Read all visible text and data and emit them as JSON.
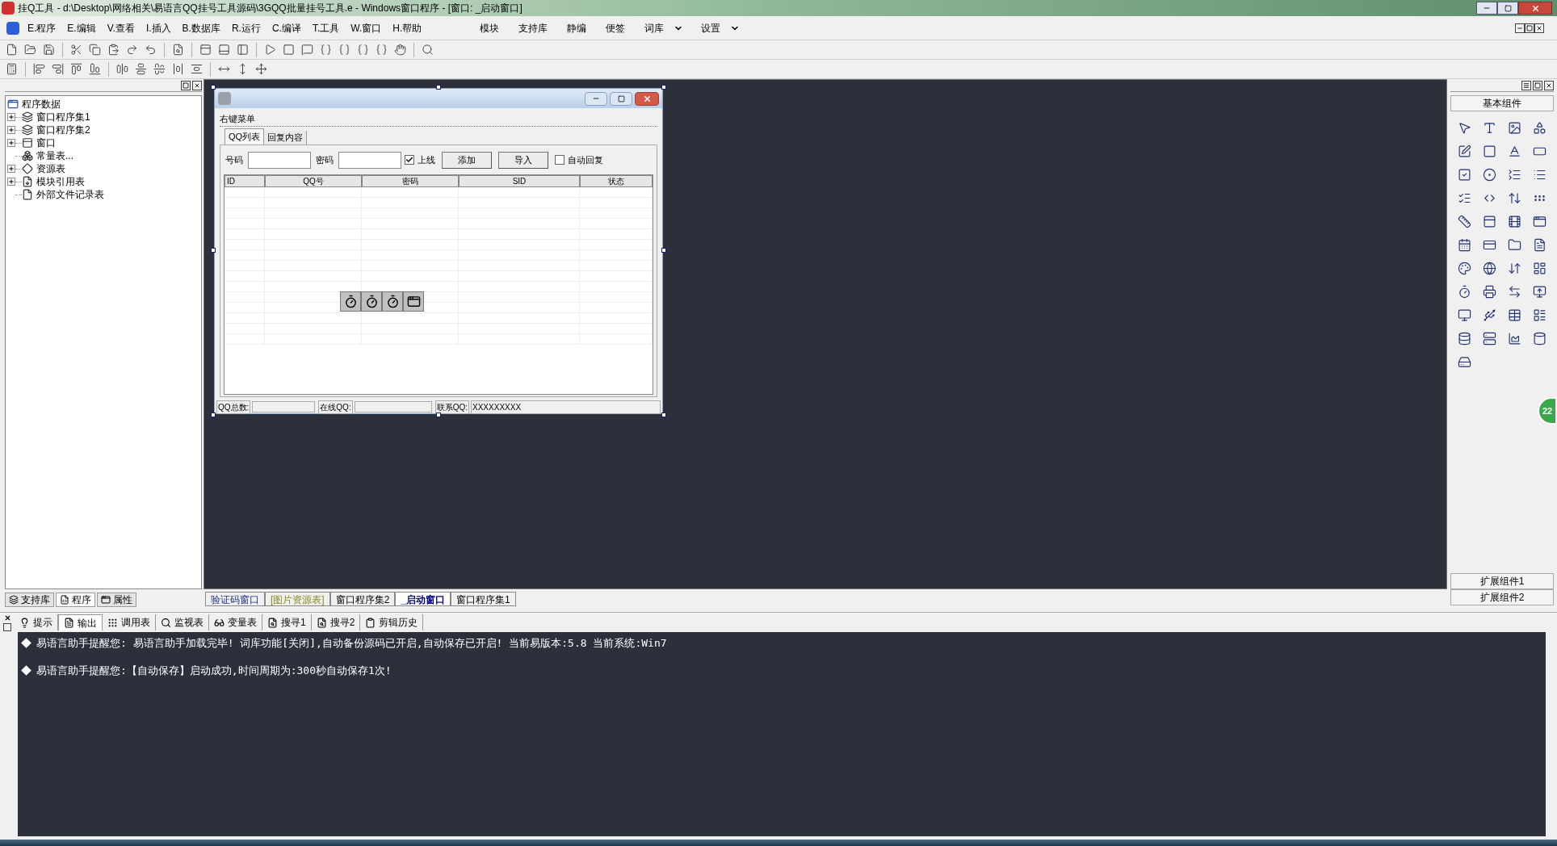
{
  "window": {
    "title": "挂Q工具 - d:\\Desktop\\网络相关\\易语言QQ挂号工具源码\\3GQQ批量挂号工具.e - Windows窗口程序 - [窗口: _启动窗口]"
  },
  "menu": [
    "E.程序",
    "E.编辑",
    "V.查看",
    "I.插入",
    "B.数据库",
    "R.运行",
    "C.编译",
    "T.工具",
    "W.窗口",
    "H.帮助"
  ],
  "menu_right": [
    {
      "label": "模块",
      "dropdown": false
    },
    {
      "label": "支持库",
      "dropdown": false
    },
    {
      "label": "静编",
      "dropdown": false
    },
    {
      "label": "便签",
      "dropdown": false
    },
    {
      "label": "词库",
      "dropdown": true
    },
    {
      "label": "设置",
      "dropdown": true
    }
  ],
  "project_tree": {
    "root": "程序数据",
    "children": [
      {
        "label": "窗口程序集1",
        "kind": "group",
        "expanded": false
      },
      {
        "label": "窗口程序集2",
        "kind": "group",
        "expanded": false
      },
      {
        "label": "窗口",
        "kind": "group",
        "expanded": false
      },
      {
        "label": "常量表...",
        "kind": "leaf"
      },
      {
        "label": "资源表",
        "kind": "group",
        "expanded": false
      },
      {
        "label": "模块引用表",
        "kind": "group",
        "expanded": false
      },
      {
        "label": "外部文件记录表",
        "kind": "leaf"
      }
    ]
  },
  "left_tabs": [
    {
      "label": "支持库",
      "selected": false
    },
    {
      "label": "程序",
      "selected": true
    },
    {
      "label": "属性",
      "selected": false
    }
  ],
  "form": {
    "menu_label": "右键菜单",
    "tabs": [
      {
        "label": "QQ列表",
        "selected": true
      },
      {
        "label": "回复内容",
        "selected": false
      }
    ],
    "fields": [
      {
        "label": "号码"
      },
      {
        "label": "密码"
      }
    ],
    "online": {
      "label": "上线",
      "checked": true
    },
    "buttons": [
      "添加",
      "导入"
    ],
    "auto_reply": {
      "label": "自动回复",
      "checked": false
    },
    "columns": [
      "ID",
      "QQ号",
      "密码",
      "SID",
      "状态"
    ],
    "status": [
      {
        "label": "QQ总数:"
      },
      {
        "label": "在线QQ:"
      },
      {
        "label": "联系QQ:",
        "value": "XXXXXXXXX"
      }
    ]
  },
  "designer_tabs": [
    {
      "label": "验证码窗口",
      "selected": false
    },
    {
      "label": "[图片资源表]",
      "selected": false
    },
    {
      "label": "窗口程序集2",
      "selected": false
    },
    {
      "label": "_启动窗口",
      "selected": true
    },
    {
      "label": "窗口程序集1",
      "selected": false
    }
  ],
  "palette": {
    "title": "基本组件",
    "footer": [
      "扩展组件1",
      "扩展组件2"
    ]
  },
  "output_tabs": [
    {
      "label": "提示",
      "selected": false
    },
    {
      "label": "输出",
      "selected": true
    },
    {
      "label": "调用表",
      "selected": false
    },
    {
      "label": "监视表",
      "selected": false
    },
    {
      "label": "变量表",
      "selected": false
    },
    {
      "label": "搜寻1",
      "selected": false
    },
    {
      "label": "搜寻2",
      "selected": false
    },
    {
      "label": "剪辑历史",
      "selected": false
    }
  ],
  "output_lines": [
    "易语言助手提醒您:  易语言助手加载完毕! 词库功能[关闭],自动备份源码已开启,自动保存已开启! 当前易版本:5.8 当前系统:Win7",
    "易语言助手提醒您:【自动保存】启动成功,时间周期为:300秒自动保存1次!"
  ],
  "floating_ball": "22"
}
